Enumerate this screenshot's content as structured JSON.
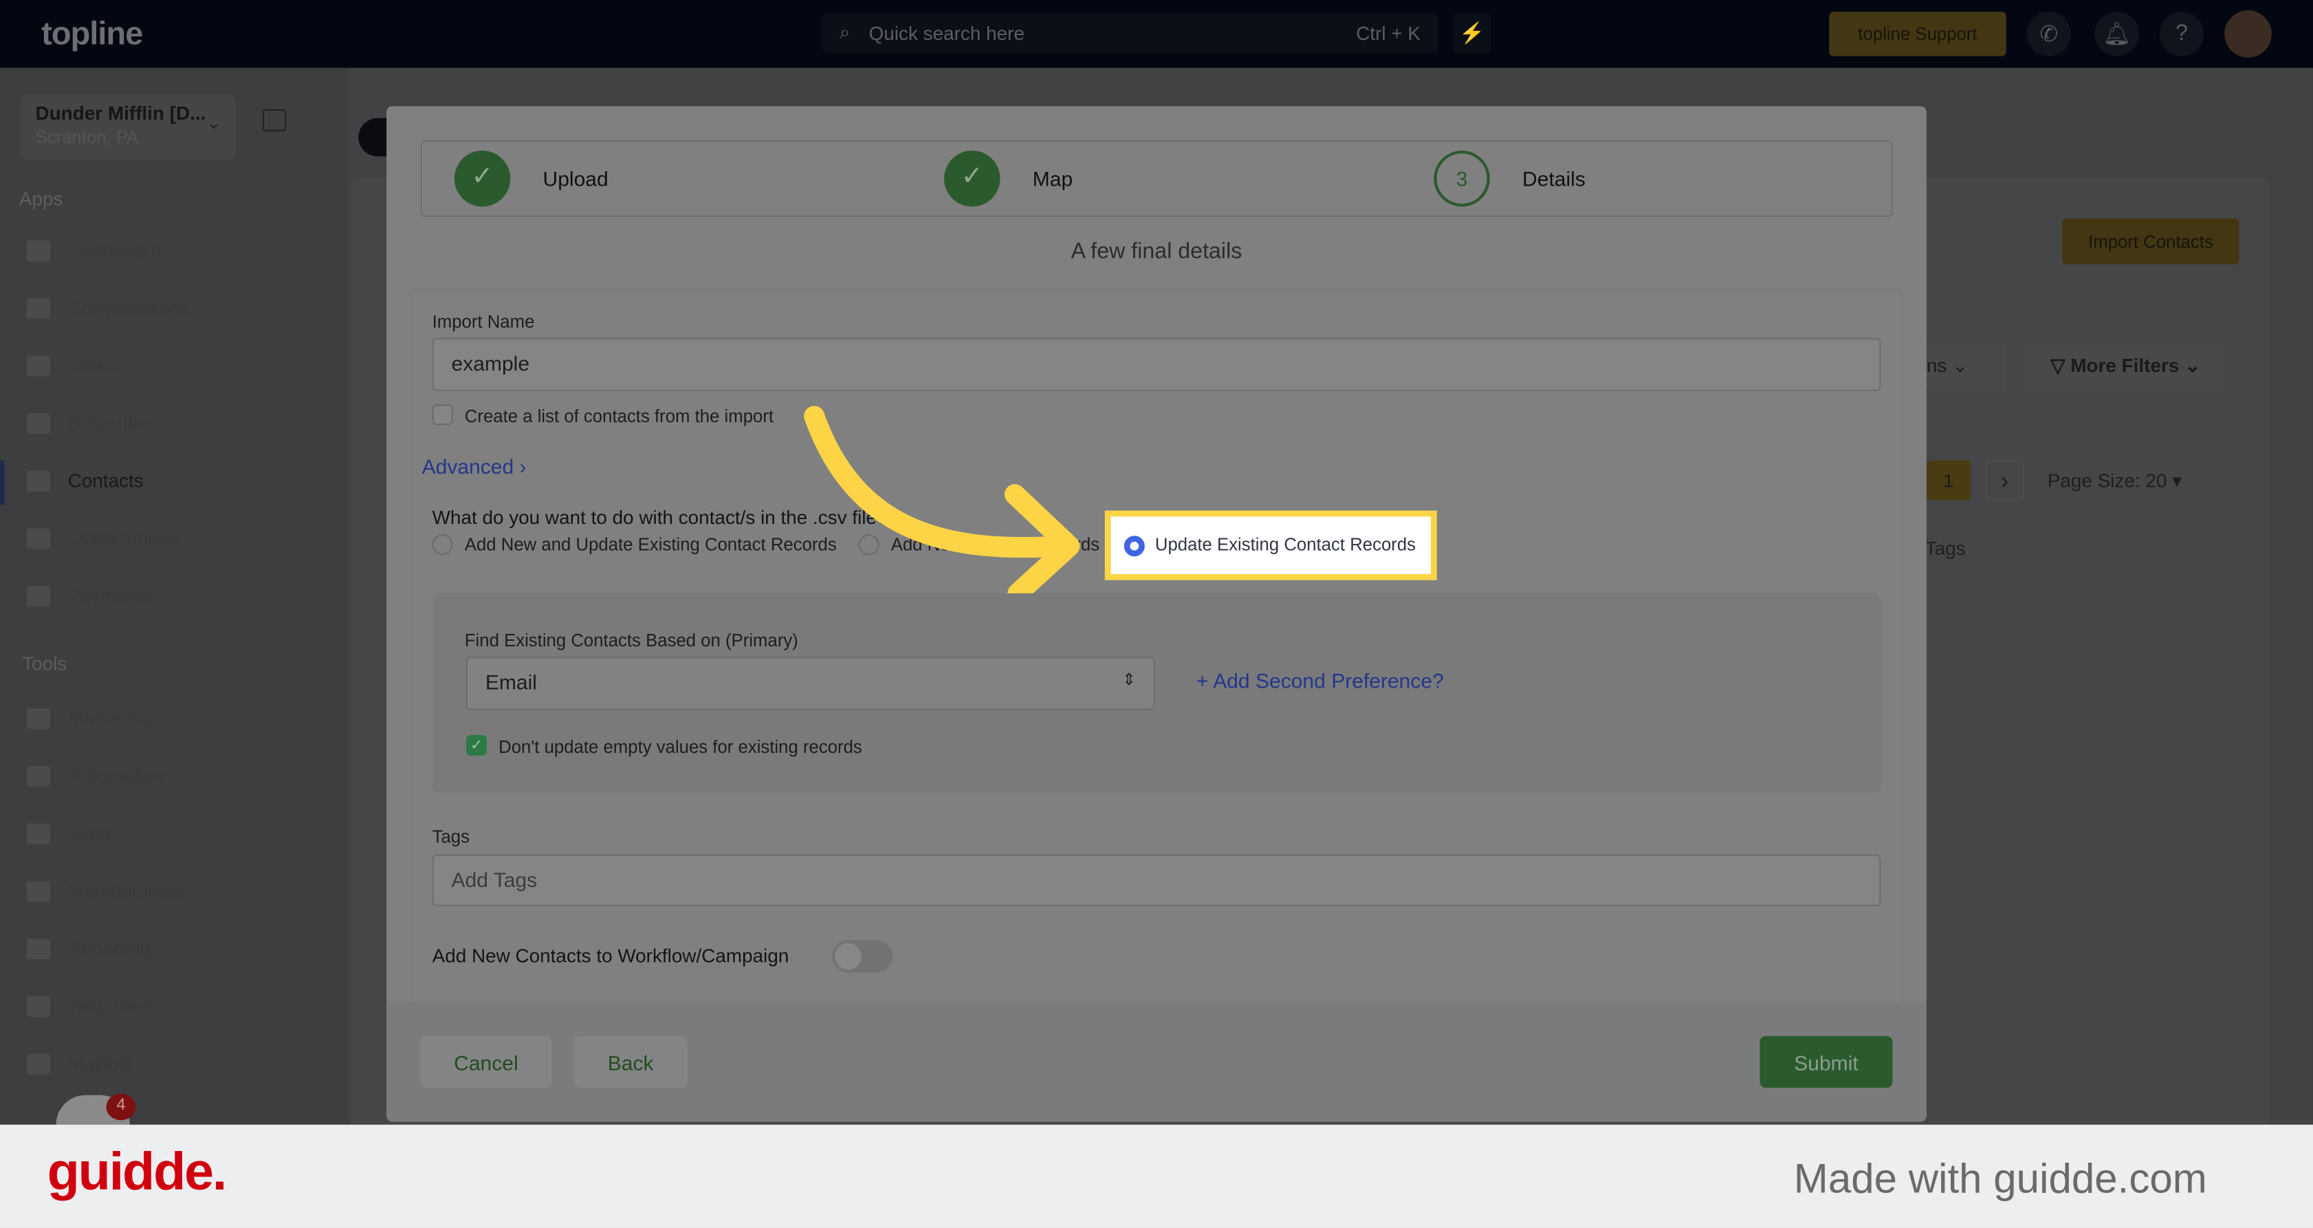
{
  "topbar": {
    "logo": "topline",
    "search_placeholder": "Quick search here",
    "search_shortcut": "Ctrl + K",
    "support": "topline Support"
  },
  "sidebar": {
    "org_name": "Dunder Mifflin [D...",
    "org_location": "Scranton, PA",
    "apps_label": "Apps",
    "tools_label": "Tools",
    "apps": [
      {
        "label": "Dashboard"
      },
      {
        "label": "Conversations"
      },
      {
        "label": "Tasks"
      },
      {
        "label": "Scheduler"
      },
      {
        "label": "Contacts",
        "active": true
      },
      {
        "label": "Opportunities"
      },
      {
        "label": "Payments"
      }
    ],
    "tools": [
      {
        "label": "Marketing"
      },
      {
        "label": "Automation"
      },
      {
        "label": "Sites"
      },
      {
        "label": "Memberships"
      },
      {
        "label": "Reporting"
      },
      {
        "label": "Help Desk"
      },
      {
        "label": "Mailfold"
      }
    ],
    "notif_count": "4"
  },
  "background": {
    "import_contacts": "Import Contacts",
    "columns_partial": "ns",
    "more_filters": "More Filters",
    "page_current": "1",
    "page_size": "Page Size: 20",
    "tags_col": "Tags"
  },
  "modal": {
    "steps": [
      {
        "label": "Upload",
        "status": "done"
      },
      {
        "label": "Map",
        "status": "done"
      },
      {
        "label": "Details",
        "number": "3",
        "status": "current"
      }
    ],
    "subtitle": "A few final details",
    "import_name_label": "Import Name",
    "import_name_value": "example",
    "create_list_label": "Create a list of contacts from the import",
    "create_list_checked": false,
    "advanced": "Advanced",
    "question": "What do you want to do with contact/s in the .csv file?",
    "options": [
      {
        "label": "Add New and Update Existing Contact Records",
        "selected": false
      },
      {
        "label": "Add New Contact Records",
        "selected": false
      },
      {
        "label": "Update Existing Contact Records",
        "selected": true
      }
    ],
    "find_label": "Find Existing Contacts Based on (Primary)",
    "find_value": "Email",
    "add_second": "Add Second Preference?",
    "dont_update_label": "Don't update empty values for existing records",
    "dont_update_checked": true,
    "tags_label": "Tags",
    "tags_placeholder": "Add Tags",
    "workflow_label": "Add New Contacts to Workflow/Campaign",
    "workflow_on": false,
    "cancel": "Cancel",
    "back": "Back",
    "submit": "Submit"
  },
  "branding": {
    "logo": "guidde.",
    "made_with": "Made with guidde.com"
  },
  "colors": {
    "accent_green": "#2b5a2e",
    "highlight": "#fdd446",
    "radio_selected": "#3f66e0",
    "brand_red": "#d0000f"
  }
}
